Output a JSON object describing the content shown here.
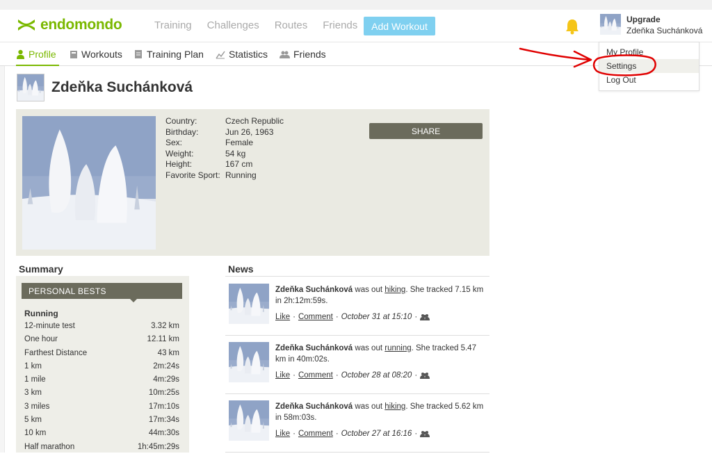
{
  "brand": {
    "name": "endomondo",
    "color": "#7ab800"
  },
  "topnav": {
    "items": [
      "Training",
      "Challenges",
      "Routes",
      "Friends"
    ],
    "add_workout": "Add Workout"
  },
  "user": {
    "upgrade": "Upgrade",
    "name": "Zdeňka Suchánková"
  },
  "dropdown": {
    "items": [
      "My Profile",
      "Settings",
      "Log Out"
    ]
  },
  "subnav": {
    "items": [
      "Profile",
      "Workouts",
      "Training Plan",
      "Statistics",
      "Friends"
    ]
  },
  "profile": {
    "name": "Zdeňka Suchánková",
    "fields": [
      {
        "k": "Country:",
        "v": "Czech Republic"
      },
      {
        "k": "Birthday:",
        "v": "Jun 26, 1963"
      },
      {
        "k": "Sex:",
        "v": "Female"
      },
      {
        "k": "Weight:",
        "v": "54 kg"
      },
      {
        "k": "Height:",
        "v": "167 cm"
      },
      {
        "k": "Favorite Sport:",
        "v": "Running"
      }
    ],
    "share": "SHARE"
  },
  "summary": {
    "title": "Summary",
    "pb_header": "PERSONAL BESTS",
    "sport": "Running",
    "rows": [
      {
        "k": "12-minute test",
        "v": "3.32 km"
      },
      {
        "k": "One hour",
        "v": "12.11 km"
      },
      {
        "k": "Farthest Distance",
        "v": "43 km"
      },
      {
        "k": "1 km",
        "v": "2m:24s"
      },
      {
        "k": "1 mile",
        "v": "4m:29s"
      },
      {
        "k": "3 km",
        "v": "10m:25s"
      },
      {
        "k": "3 miles",
        "v": "17m:10s"
      },
      {
        "k": "5 km",
        "v": "17m:34s"
      },
      {
        "k": "10 km",
        "v": "44m:30s"
      },
      {
        "k": "Half marathon",
        "v": "1h:45m:29s"
      }
    ]
  },
  "news": {
    "title": "News",
    "items": [
      {
        "name": "Zdeňka Suchánková",
        "pre": " was out ",
        "activity": "hiking",
        "post": ". She tracked 7.15 km in 2h:12m:59s.",
        "like": "Like",
        "comment": "Comment",
        "date": "October 31 at 15:10"
      },
      {
        "name": "Zdeňka Suchánková",
        "pre": " was out ",
        "activity": "running",
        "post": ". She tracked 5.47 km in 40m:02s.",
        "like": "Like",
        "comment": "Comment",
        "date": "October 28 at 08:20"
      },
      {
        "name": "Zdeňka Suchánková",
        "pre": " was out ",
        "activity": "hiking",
        "post": ". She tracked 5.62 km in 58m:03s.",
        "like": "Like",
        "comment": "Comment",
        "date": "October 27 at 16:16"
      }
    ]
  },
  "colors": {
    "accent": "#7ab800",
    "button": "#7fd0f0",
    "panel": "#eaeae2",
    "dark_button": "#6b6b5c",
    "annotation": "#e00000"
  }
}
